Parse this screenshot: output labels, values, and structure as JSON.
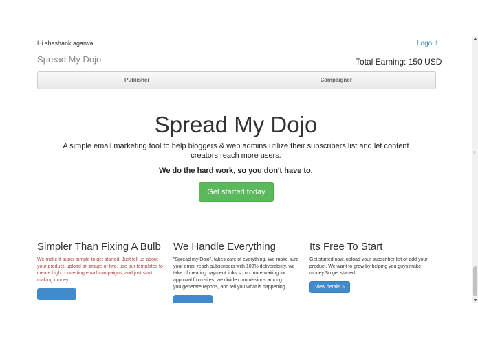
{
  "header": {
    "greeting": "Hi shashank agarwal",
    "logout": "Logout",
    "brand": "Spread My Dojo",
    "earning": "Total Earning: 150 USD"
  },
  "nav": {
    "tabs": [
      {
        "label": "Publisher"
      },
      {
        "label": "Campaigner"
      }
    ]
  },
  "hero": {
    "title": "Spread My Dojo",
    "description": "A simple email marketing tool to help bloggers & web admins utilize their subscribers list and let content creators reach more users.",
    "tagline": "We do the hard work, so you don't have to.",
    "cta": "Get started today"
  },
  "features": [
    {
      "title": "Simpler Than Fixing A Bulb",
      "text": "We make it super simple to get started. Just tell us about your product, upload an image or two, use our templates to create high converting email campaigns, and just start making money."
    },
    {
      "title": "We Handle Everything",
      "text": "\"Spread my Dojo\", takes care of everything. We make sure your email reach subscribers with 100% deliverability, we take of creating payment links so no more waiting for approval from sites, we divide commissions among you,generate reports, and tell you what is happening."
    },
    {
      "title": "Its Free To Start",
      "text": "Get started now, upload your subscriber list or add your product. We want to grow by helping you guys make money.So get started.",
      "button": "View details »"
    }
  ],
  "colors": {
    "primary": "#428bca",
    "success": "#5cb85c",
    "danger_text": "#a94442"
  }
}
